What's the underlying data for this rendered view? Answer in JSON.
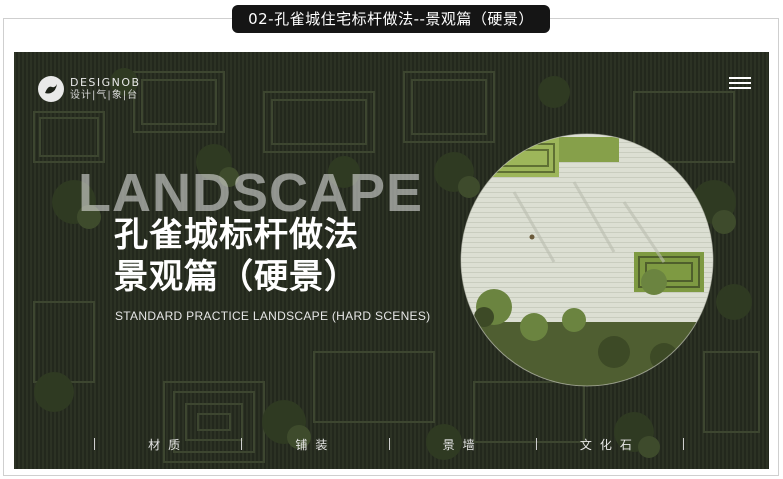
{
  "caption": {
    "text": "02-孔雀城住宅标杆做法--景观篇（硬景）"
  },
  "banner": {
    "logo": {
      "name": "DESIGNOB",
      "sub": "设计|气|象|台"
    },
    "bg_word": "LANDSCAPE",
    "title_line1": "孔雀城标杆做法",
    "title_line2": "景观篇（硬景）",
    "subtitle": "STANDARD PRACTICE LANDSCAPE (HARD SCENES)",
    "nav": [
      {
        "label": "材质"
      },
      {
        "label": "铺装"
      },
      {
        "label": "景墙"
      },
      {
        "label": "文化石"
      }
    ],
    "icons": {
      "menu": "hamburger-menu-icon",
      "logo": "designob-logo-icon"
    }
  },
  "colors": {
    "caption_bg": "#151515",
    "banner_dark": "#1d2119",
    "foliage": "#4a5a2e",
    "lawn": "#9db65a",
    "paving": "#d8dccf"
  }
}
